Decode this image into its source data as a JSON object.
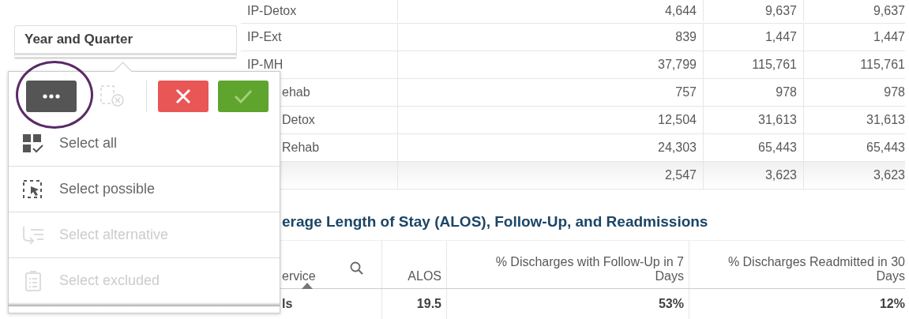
{
  "filter": {
    "title": "Year and Quarter"
  },
  "top_table": {
    "rows": [
      {
        "name": "IP-Detox",
        "values": [
          "4,644",
          "9,637",
          "9,637"
        ]
      },
      {
        "name": "IP-Ext",
        "values": [
          "839",
          "1,447",
          "1,447"
        ]
      },
      {
        "name": "IP-MH",
        "values": [
          "37,799",
          "115,761",
          "115,761"
        ]
      }
    ],
    "partly_hidden_rows": [
      {
        "name": "ehab",
        "values": [
          "757",
          "978",
          "978"
        ]
      },
      {
        "name": "Detox",
        "values": [
          "12,504",
          "31,613",
          "31,613"
        ]
      },
      {
        "name": "Rehab",
        "values": [
          "24,303",
          "65,443",
          "65,443"
        ]
      }
    ],
    "last_row": {
      "values": [
        "2,547",
        "3,623",
        "3,623"
      ]
    }
  },
  "section_title": "erage Length of Stay (ALOS), Follow-Up, and Readmissions",
  "bottom_table": {
    "columns": [
      {
        "label": "ervice",
        "search": true,
        "sorted": true
      },
      {
        "label": "ALOS",
        "search": false,
        "sorted": false
      },
      {
        "label": "% Discharges with Follow-Up in 7 Days",
        "search": false,
        "sorted": false
      },
      {
        "label": "% Discharges Readmitted in 30 Days",
        "search": false,
        "sorted": false
      }
    ],
    "rows": [
      [
        "ls",
        "19.5",
        "53%",
        "12%"
      ]
    ]
  },
  "popup": {
    "toolbar": [
      {
        "kind": "more",
        "disabled": false
      },
      {
        "kind": "clear",
        "disabled": true
      },
      {
        "kind": "cancel",
        "disabled": false
      },
      {
        "kind": "confirm",
        "disabled": false
      }
    ],
    "menu": [
      {
        "kind": "all",
        "label": "Select all",
        "disabled": false
      },
      {
        "kind": "possible",
        "label": "Select possible",
        "disabled": false
      },
      {
        "kind": "alternative",
        "label": "Select alternative",
        "disabled": true
      },
      {
        "kind": "excluded",
        "label": "Select excluded",
        "disabled": true
      }
    ]
  }
}
